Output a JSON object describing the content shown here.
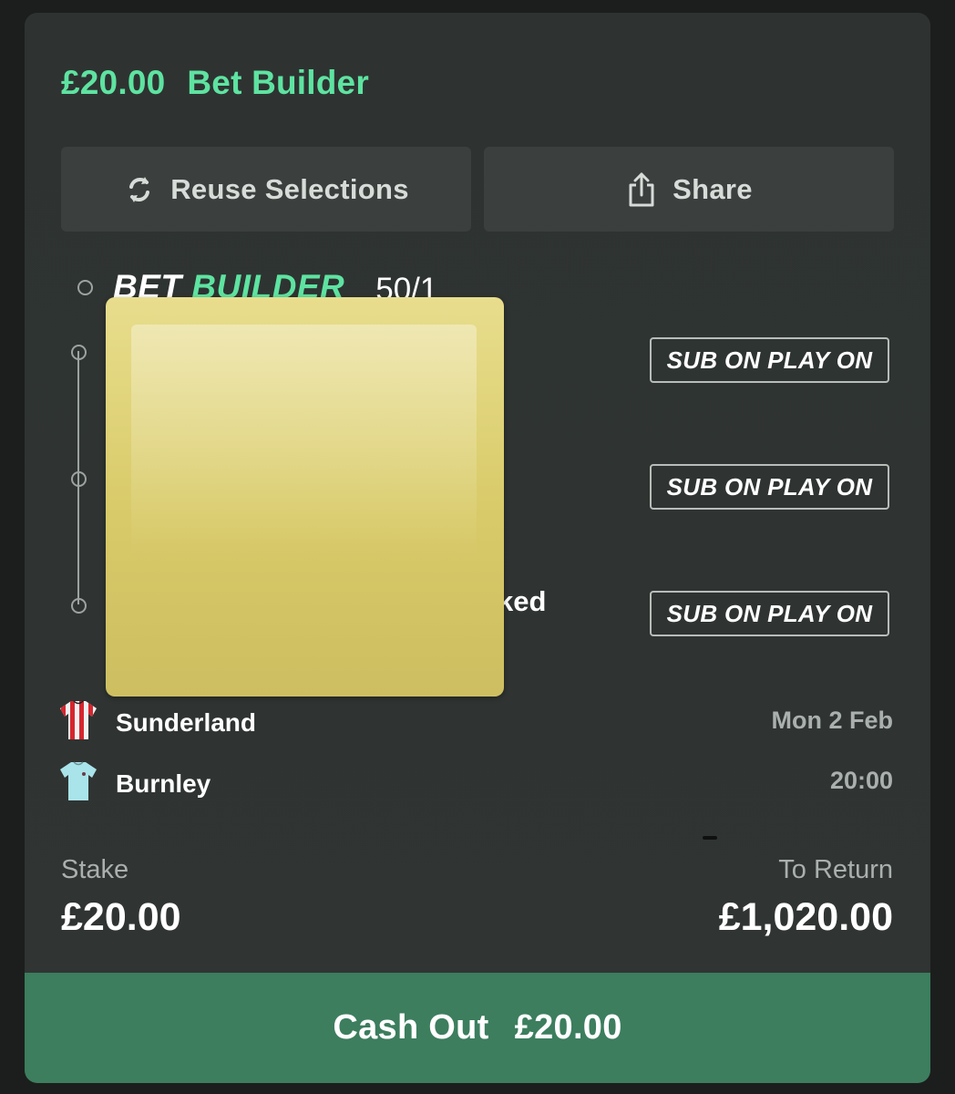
{
  "header": {
    "amount": "£20.00",
    "bet_type": "Bet Builder"
  },
  "actions": {
    "reuse_label": "Reuse Selections",
    "share_label": "Share"
  },
  "bet_builder": {
    "logo_word1": "BET",
    "logo_word2": "BUILDER",
    "odds": "50/1"
  },
  "legs": [
    {
      "badge": "SUB ON PLAY ON"
    },
    {
      "badge": "SUB ON PLAY ON"
    },
    {
      "badge": "SUB ON PLAY ON",
      "partial_text": "ked"
    }
  ],
  "match": {
    "home": "Sunderland",
    "away": "Burnley",
    "date": "Mon 2 Feb",
    "time": "20:00"
  },
  "stake": {
    "label": "Stake",
    "value": "£20.00"
  },
  "to_return": {
    "label": "To Return",
    "value": "£1,020.00"
  },
  "cashout": {
    "label": "Cash Out",
    "amount": "£20.00"
  },
  "icons": {
    "reuse": "refresh-icon",
    "share": "share-icon",
    "home_kit": "red-white-striped-shirt-icon",
    "away_kit": "light-blue-shirt-icon"
  },
  "colors": {
    "accent_green": "#5ee3a1",
    "cashout_bg": "#3c7e5e",
    "card_bg": "#2f3432",
    "redaction_yellow": "#d8ca68"
  }
}
